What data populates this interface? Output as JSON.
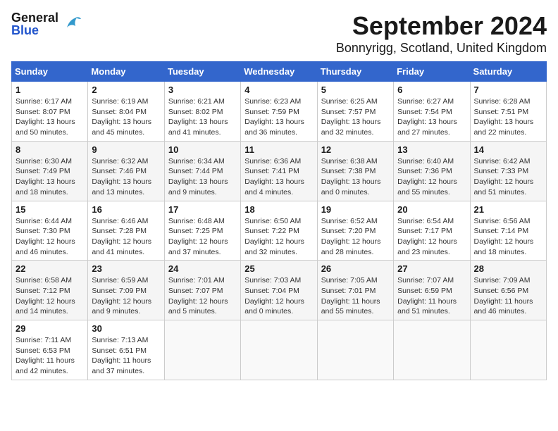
{
  "header": {
    "logo_general": "General",
    "logo_blue": "Blue",
    "title": "September 2024",
    "subtitle": "Bonnyrigg, Scotland, United Kingdom"
  },
  "weekdays": [
    "Sunday",
    "Monday",
    "Tuesday",
    "Wednesday",
    "Thursday",
    "Friday",
    "Saturday"
  ],
  "weeks": [
    [
      {
        "day": "1",
        "info": "Sunrise: 6:17 AM\nSunset: 8:07 PM\nDaylight: 13 hours\nand 50 minutes."
      },
      {
        "day": "2",
        "info": "Sunrise: 6:19 AM\nSunset: 8:04 PM\nDaylight: 13 hours\nand 45 minutes."
      },
      {
        "day": "3",
        "info": "Sunrise: 6:21 AM\nSunset: 8:02 PM\nDaylight: 13 hours\nand 41 minutes."
      },
      {
        "day": "4",
        "info": "Sunrise: 6:23 AM\nSunset: 7:59 PM\nDaylight: 13 hours\nand 36 minutes."
      },
      {
        "day": "5",
        "info": "Sunrise: 6:25 AM\nSunset: 7:57 PM\nDaylight: 13 hours\nand 32 minutes."
      },
      {
        "day": "6",
        "info": "Sunrise: 6:27 AM\nSunset: 7:54 PM\nDaylight: 13 hours\nand 27 minutes."
      },
      {
        "day": "7",
        "info": "Sunrise: 6:28 AM\nSunset: 7:51 PM\nDaylight: 13 hours\nand 22 minutes."
      }
    ],
    [
      {
        "day": "8",
        "info": "Sunrise: 6:30 AM\nSunset: 7:49 PM\nDaylight: 13 hours\nand 18 minutes."
      },
      {
        "day": "9",
        "info": "Sunrise: 6:32 AM\nSunset: 7:46 PM\nDaylight: 13 hours\nand 13 minutes."
      },
      {
        "day": "10",
        "info": "Sunrise: 6:34 AM\nSunset: 7:44 PM\nDaylight: 13 hours\nand 9 minutes."
      },
      {
        "day": "11",
        "info": "Sunrise: 6:36 AM\nSunset: 7:41 PM\nDaylight: 13 hours\nand 4 minutes."
      },
      {
        "day": "12",
        "info": "Sunrise: 6:38 AM\nSunset: 7:38 PM\nDaylight: 13 hours\nand 0 minutes."
      },
      {
        "day": "13",
        "info": "Sunrise: 6:40 AM\nSunset: 7:36 PM\nDaylight: 12 hours\nand 55 minutes."
      },
      {
        "day": "14",
        "info": "Sunrise: 6:42 AM\nSunset: 7:33 PM\nDaylight: 12 hours\nand 51 minutes."
      }
    ],
    [
      {
        "day": "15",
        "info": "Sunrise: 6:44 AM\nSunset: 7:30 PM\nDaylight: 12 hours\nand 46 minutes."
      },
      {
        "day": "16",
        "info": "Sunrise: 6:46 AM\nSunset: 7:28 PM\nDaylight: 12 hours\nand 41 minutes."
      },
      {
        "day": "17",
        "info": "Sunrise: 6:48 AM\nSunset: 7:25 PM\nDaylight: 12 hours\nand 37 minutes."
      },
      {
        "day": "18",
        "info": "Sunrise: 6:50 AM\nSunset: 7:22 PM\nDaylight: 12 hours\nand 32 minutes."
      },
      {
        "day": "19",
        "info": "Sunrise: 6:52 AM\nSunset: 7:20 PM\nDaylight: 12 hours\nand 28 minutes."
      },
      {
        "day": "20",
        "info": "Sunrise: 6:54 AM\nSunset: 7:17 PM\nDaylight: 12 hours\nand 23 minutes."
      },
      {
        "day": "21",
        "info": "Sunrise: 6:56 AM\nSunset: 7:14 PM\nDaylight: 12 hours\nand 18 minutes."
      }
    ],
    [
      {
        "day": "22",
        "info": "Sunrise: 6:58 AM\nSunset: 7:12 PM\nDaylight: 12 hours\nand 14 minutes."
      },
      {
        "day": "23",
        "info": "Sunrise: 6:59 AM\nSunset: 7:09 PM\nDaylight: 12 hours\nand 9 minutes."
      },
      {
        "day": "24",
        "info": "Sunrise: 7:01 AM\nSunset: 7:07 PM\nDaylight: 12 hours\nand 5 minutes."
      },
      {
        "day": "25",
        "info": "Sunrise: 7:03 AM\nSunset: 7:04 PM\nDaylight: 12 hours\nand 0 minutes."
      },
      {
        "day": "26",
        "info": "Sunrise: 7:05 AM\nSunset: 7:01 PM\nDaylight: 11 hours\nand 55 minutes."
      },
      {
        "day": "27",
        "info": "Sunrise: 7:07 AM\nSunset: 6:59 PM\nDaylight: 11 hours\nand 51 minutes."
      },
      {
        "day": "28",
        "info": "Sunrise: 7:09 AM\nSunset: 6:56 PM\nDaylight: 11 hours\nand 46 minutes."
      }
    ],
    [
      {
        "day": "29",
        "info": "Sunrise: 7:11 AM\nSunset: 6:53 PM\nDaylight: 11 hours\nand 42 minutes."
      },
      {
        "day": "30",
        "info": "Sunrise: 7:13 AM\nSunset: 6:51 PM\nDaylight: 11 hours\nand 37 minutes."
      },
      {
        "day": "",
        "info": ""
      },
      {
        "day": "",
        "info": ""
      },
      {
        "day": "",
        "info": ""
      },
      {
        "day": "",
        "info": ""
      },
      {
        "day": "",
        "info": ""
      }
    ]
  ]
}
